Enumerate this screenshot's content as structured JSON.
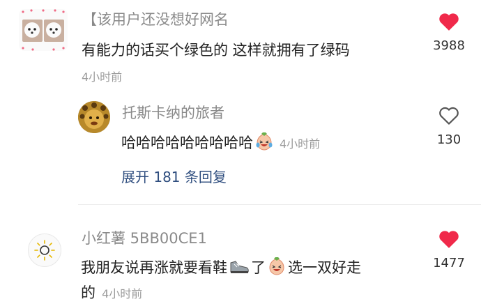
{
  "comments": [
    {
      "username": "【该用户还没想好网名",
      "text": "有能力的话买个绿色的 这样就拥有了绿码",
      "time": "4小时前",
      "likes": "3988",
      "liked": true,
      "reply": {
        "username": "托斯卡纳的旅者",
        "text": "哈哈哈哈哈哈哈哈哈",
        "time": "4小时前",
        "likes": "130",
        "liked": false
      },
      "expand_label": "展开 181 条回复"
    },
    {
      "username": "小红薯 5BB00CE1",
      "text_a": "我朋友说再涨就要看鞋",
      "text_b": "了",
      "text_c": "选一双好走",
      "text_d": "的",
      "time": "4小时前",
      "likes": "1477",
      "liked": true
    }
  ],
  "colors": {
    "heart_liked": "#f0294a",
    "heart_outline": "#555555",
    "expand_link": "#2f4e7f",
    "muted": "#8a8a8a"
  },
  "icons": [
    "heart-filled-icon",
    "heart-outline-icon",
    "crying-laughing-emoji-icon",
    "shoe-emoji-icon",
    "sun-icon"
  ]
}
